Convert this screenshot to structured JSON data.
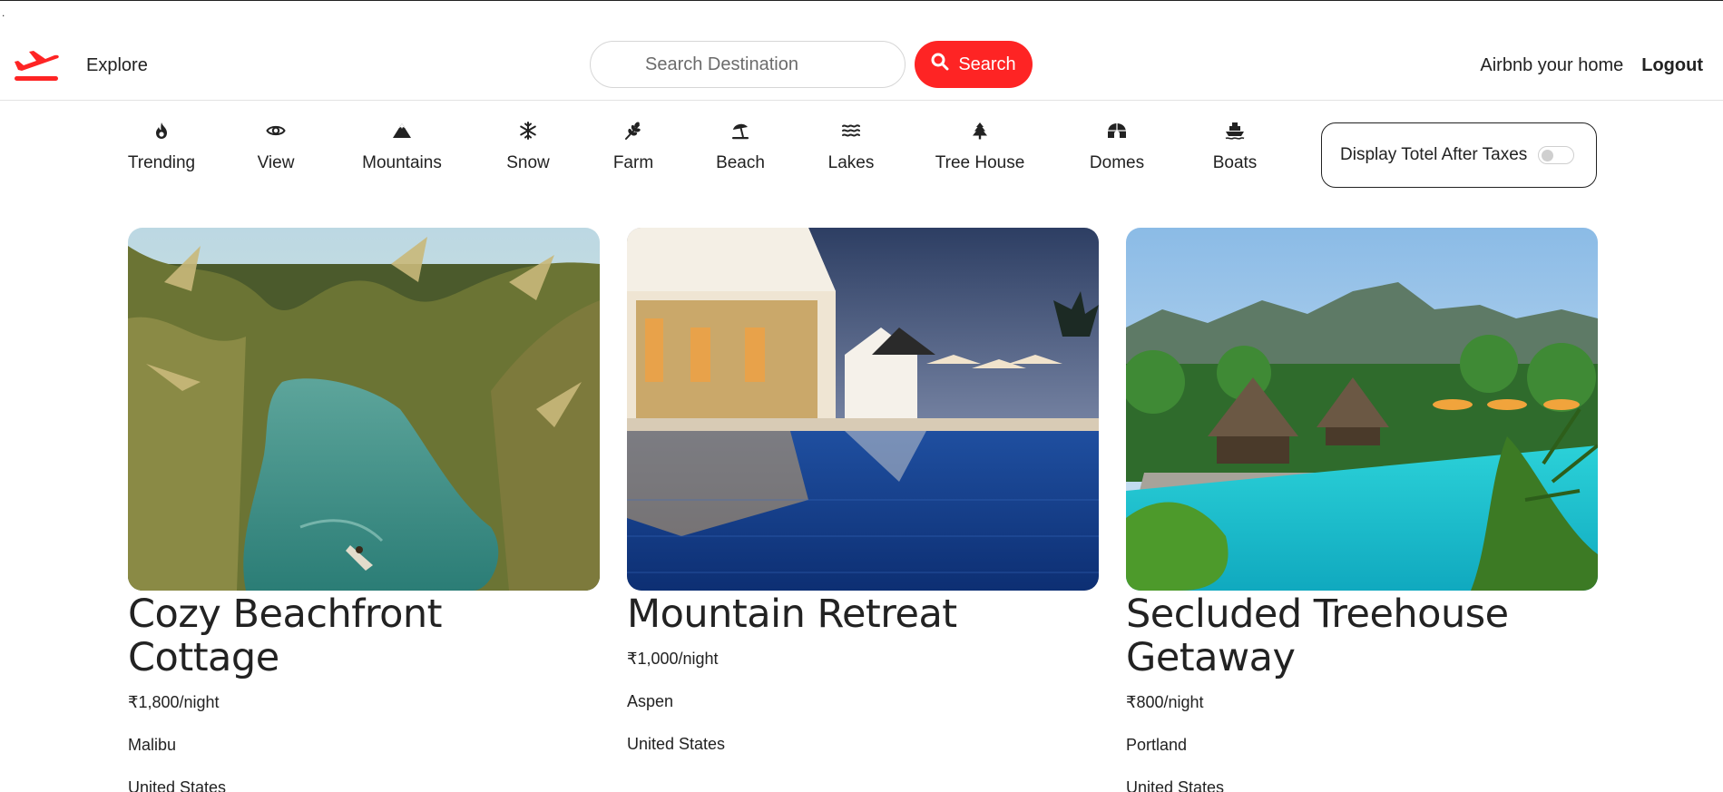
{
  "corner_mark": ".",
  "navbar": {
    "logo_icon": "plane-icon",
    "brand_color": "#fe2424",
    "explore_label": "Explore",
    "search_placeholder": "Search Destination",
    "search_button_label": "Search",
    "host_label": "Airbnb your home",
    "logout_label": "Logout"
  },
  "filters": [
    {
      "icon": "fire-icon",
      "label": "Trending"
    },
    {
      "icon": "eye-icon",
      "label": "View"
    },
    {
      "icon": "mountain-icon",
      "label": "Mountains"
    },
    {
      "icon": "snowflake-icon",
      "label": "Snow"
    },
    {
      "icon": "wheat-icon",
      "label": "Farm"
    },
    {
      "icon": "umbrella-beach-icon",
      "label": "Beach"
    },
    {
      "icon": "water-icon",
      "label": "Lakes"
    },
    {
      "icon": "tree-icon",
      "label": "Tree House"
    },
    {
      "icon": "igloo-icon",
      "label": "Domes"
    },
    {
      "icon": "ship-icon",
      "label": "Boats"
    }
  ],
  "tax_toggle": {
    "label": "Display Totel After Taxes",
    "enabled": false
  },
  "listings": [
    {
      "title": "Cozy Beachfront Cottage",
      "price": "₹1,800/night",
      "location": "Malibu",
      "country": "United States"
    },
    {
      "title": "Mountain Retreat",
      "price": "₹1,000/night",
      "location": "Aspen",
      "country": "United States"
    },
    {
      "title": "Secluded Treehouse Getaway",
      "price": "₹800/night",
      "location": "Portland",
      "country": "United States"
    }
  ]
}
